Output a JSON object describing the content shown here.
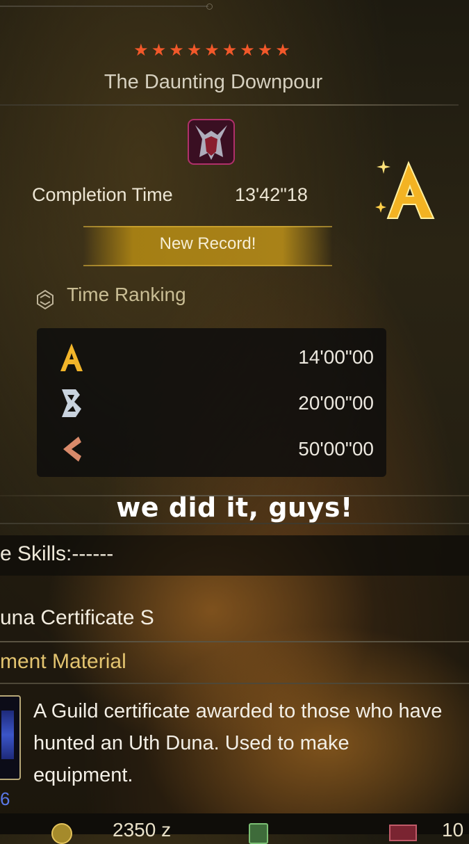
{
  "quest": {
    "stars": "★★★★★★★★★",
    "title": "The Daunting Downpour",
    "monster_icon": "uth-duna-icon"
  },
  "result": {
    "completion_label": "Completion Time",
    "completion_time": "13'42\"18",
    "rank": "A",
    "record_banner": "New Record!"
  },
  "time_ranking": {
    "label": "Time Ranking",
    "rows": [
      {
        "rank": "A",
        "time": "14'00\"00",
        "color": "#f2b52a"
      },
      {
        "rank": "B",
        "time": "20'00\"00",
        "color": "#c9d3de"
      },
      {
        "rank": "C",
        "time": "50'00\"00",
        "color": "#d98a6a"
      }
    ]
  },
  "caption": "we did it, guys!",
  "reward": {
    "skills": "e Skills:------",
    "item_name": "una Certificate S",
    "item_type": "ment Material",
    "description": "A Guild certificate awarded to those who have hunted an Uth Duna. Used to make equipment.",
    "count": "6"
  },
  "footer": {
    "zenny": "2350 z",
    "rest": "10"
  },
  "colors": {
    "star": "#f2582a",
    "gold": "#e3c470",
    "banner": "#aa8214"
  }
}
